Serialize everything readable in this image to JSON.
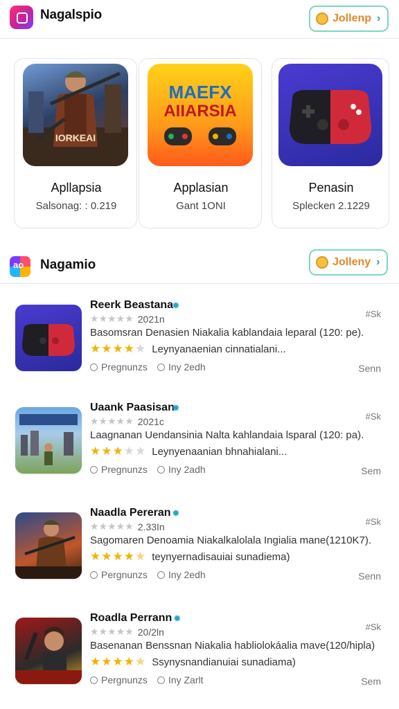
{
  "header": {
    "title": "Nagalspio",
    "follow_label": "Jollenp"
  },
  "featured": [
    {
      "title": "Apllapsia",
      "subtitle": "Salsonag: : 0.219",
      "art_text": "IORKEAI"
    },
    {
      "title": "Applasian",
      "subtitle": "Gant 1ONI",
      "art_text": "MAEFX AIIARSIA"
    },
    {
      "title": "Penasin",
      "subtitle": "Splecken 2.1229",
      "art_text": ""
    }
  ],
  "section": {
    "title": "Nagamio",
    "follow_label": "Jolleny"
  },
  "list": [
    {
      "name": "Reerk Beastana",
      "meta_number": "2021n",
      "description": "Basomsran Denasien Niakalia kablandaia leparal (120: pe).",
      "rating_text": "Leynyanaenian cinnatialani...",
      "stars": 3.5,
      "tag1": "Pregnunzs",
      "tag2": "Iny 2edh",
      "size": "#Sk",
      "action": "Senn"
    },
    {
      "name": "Uaank Paasisan",
      "meta_number": "2021с",
      "description": "Laagnanan Uendansinia Nalta kahlandaia lsparal (120: pa).",
      "rating_text": "Leynyenaanian bhnahialani...",
      "stars": 3.5,
      "tag1": "Pregnunzs",
      "tag2": "Iny 2adh",
      "size": "#Sk",
      "action": "Sem"
    },
    {
      "name": "Naadla Pereran",
      "meta_number": "2.33In",
      "description": "Sagomaren Denoamia Niakalkalolala Ingialia mane(1210K7).",
      "rating_text": "teynyernadisauiai sunadiema)",
      "stars": 4.5,
      "tag1": "Pergnunzs",
      "tag2": "Iny 2edh",
      "size": "#Sk",
      "action": "Senn"
    },
    {
      "name": "Roadla Perrann",
      "meta_number": "20/2ln",
      "description": "Basenanan Benssnan Niakalia habliolokáalia mave(120/hipla)",
      "rating_text": "Ssynysnandianuiai sunadiama)",
      "stars": 4.5,
      "tag1": "Pergnunzs",
      "tag2": "Iny Zarlt",
      "size": "#Sk",
      "action": "Sem"
    }
  ]
}
